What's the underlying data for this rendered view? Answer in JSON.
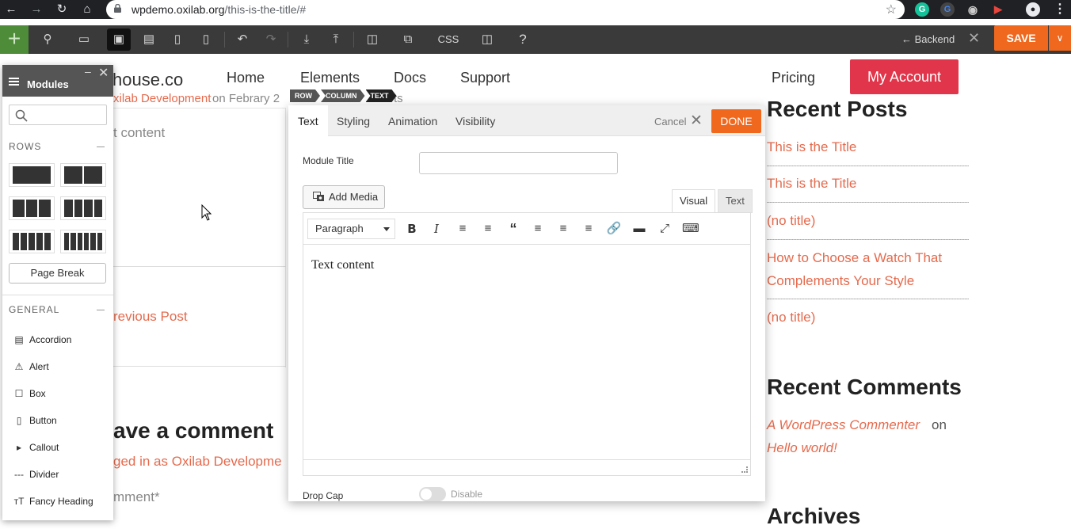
{
  "browser": {
    "url_host": "wpdemo.oxilab.org",
    "url_path": "/this-is-the-title/#",
    "back_icon": "arrow-left-icon",
    "forward_icon": "arrow-right-icon",
    "reload_icon": "reload-icon",
    "home_icon": "home-icon"
  },
  "toolbar": {
    "css_label": "CSS",
    "help_label": "?",
    "backend_label": "Backend",
    "save_label": "SAVE",
    "colors": {
      "accent": "#f0681e",
      "bar": "#3a3a3a",
      "add": "#4e8c3a"
    }
  },
  "site": {
    "logo_text": "house.co",
    "nav": [
      "Home",
      "Elements",
      "Docs",
      "Support",
      "Pricing"
    ],
    "my_account": "My Account",
    "accent": "#e0354a"
  },
  "page_background": {
    "author_line": "xilab Development",
    "date_fragment": "on Febrary 2",
    "comments_fragment": "ts",
    "text_content": "t content",
    "previous_post": "revious Post",
    "leave_comment": "ave a comment",
    "logged_in": "ged in as Oxilab Developme",
    "comment_label": "mment*"
  },
  "sidebar": {
    "recent_posts_title": "Recent Posts",
    "recent_posts": [
      "This is the Title",
      "This is the Title",
      "(no title)",
      "How to Choose a Watch That Complements Your Style",
      "(no title)"
    ],
    "recent_comments_title": "Recent Comments",
    "commenter": "A WordPress Commenter",
    "on_word": "on",
    "comment_post": "Hello world!",
    "archives_title": "Archives"
  },
  "modules_panel": {
    "title": "Modules",
    "search_placeholder": "",
    "rows_label": "ROWS",
    "page_break": "Page Break",
    "general_label": "GENERAL",
    "items": [
      {
        "label": "Accordion",
        "icon": "accordion-icon",
        "glyph": "▤"
      },
      {
        "label": "Alert",
        "icon": "alert-icon",
        "glyph": "⚠"
      },
      {
        "label": "Box",
        "icon": "box-icon",
        "glyph": "☐"
      },
      {
        "label": "Button",
        "icon": "button-icon",
        "glyph": "▯"
      },
      {
        "label": "Callout",
        "icon": "callout-icon",
        "glyph": "📢"
      },
      {
        "label": "Divider",
        "icon": "divider-icon",
        "glyph": "---"
      },
      {
        "label": "Fancy Heading",
        "icon": "fancy-heading-icon",
        "glyph": "тT"
      }
    ]
  },
  "breadcrumb": [
    "ROW",
    "COLUMN",
    "TEXT"
  ],
  "editor": {
    "tabs": [
      "Text",
      "Styling",
      "Animation",
      "Visibility"
    ],
    "cancel": "Cancel",
    "done": "DONE",
    "module_title_label": "Module Title",
    "module_title_value": "",
    "add_media": "Add Media",
    "visual_tab": "Visual",
    "text_tab": "Text",
    "format_select": "Paragraph",
    "body_text": "Text content",
    "drop_cap_label": "Drop Cap",
    "drop_cap_state": "Disable"
  }
}
